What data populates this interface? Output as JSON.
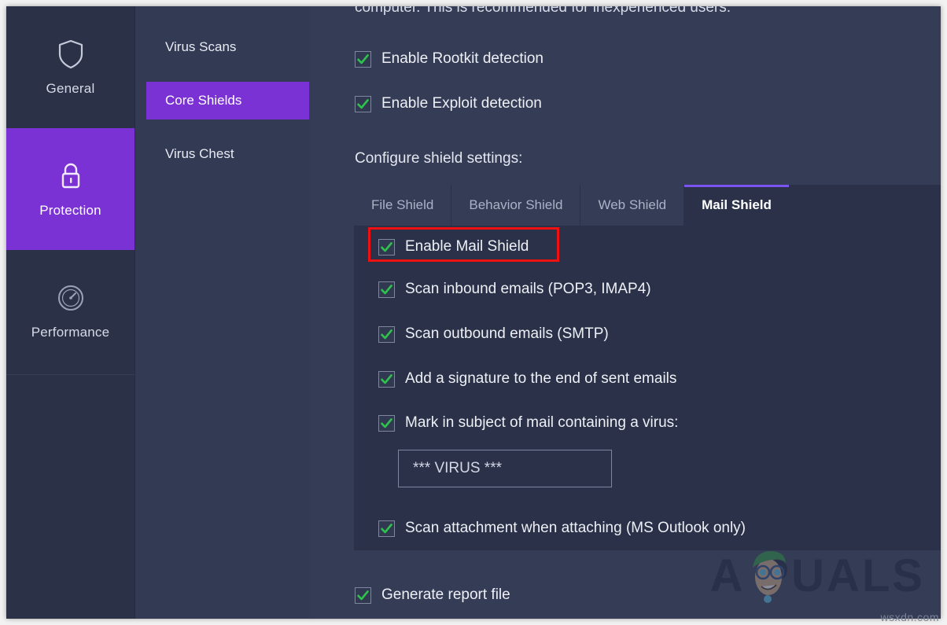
{
  "rail": {
    "items": [
      {
        "label": "General",
        "icon": "shield-icon",
        "active": false
      },
      {
        "label": "Protection",
        "icon": "lock-icon",
        "active": true
      },
      {
        "label": "Performance",
        "icon": "speedometer-icon",
        "active": false
      }
    ]
  },
  "nav2": {
    "items": [
      {
        "label": "Virus Scans",
        "active": false
      },
      {
        "label": "Core Shields",
        "active": true
      },
      {
        "label": "Virus Chest",
        "active": false
      }
    ]
  },
  "main": {
    "lede": "computer. This is recommended for inexperienced users.",
    "rootkit_label": "Enable Rootkit detection",
    "exploit_label": "Enable Exploit detection",
    "section_title": "Configure shield settings:",
    "tabs": [
      {
        "label": "File Shield",
        "active": false
      },
      {
        "label": "Behavior Shield",
        "active": false
      },
      {
        "label": "Web Shield",
        "active": false
      },
      {
        "label": "Mail Shield",
        "active": true
      }
    ],
    "panel_rows": [
      {
        "label": "Enable Mail Shield",
        "checked": true,
        "highlighted": true
      },
      {
        "label": "Scan inbound emails (POP3, IMAP4)",
        "checked": true,
        "highlighted": false
      },
      {
        "label": "Scan outbound emails (SMTP)",
        "checked": true,
        "highlighted": false
      },
      {
        "label": "Add a signature to the end of sent emails",
        "checked": true,
        "highlighted": false
      },
      {
        "label": "Mark in subject of mail containing a virus:",
        "checked": true,
        "highlighted": false
      },
      {
        "label": "Scan attachment when attaching (MS Outlook only)",
        "checked": true,
        "highlighted": false
      }
    ],
    "virus_subject_value": "*** VIRUS ***",
    "virus_subject_placeholder": "*** VIRUS ***",
    "generate_report_label": "Generate report file",
    "generate_report_checked": true
  },
  "watermark": {
    "brand": "A PUALS",
    "brand_before": "A",
    "brand_after": "PUALS",
    "credit": "wsxdn.com"
  },
  "colors": {
    "accent_purple": "#7b32d4",
    "tab_indicator": "#7b53f0",
    "check_green": "#2fc24d",
    "highlight_red": "#ee1111",
    "panel_bg": "#2a3148",
    "content_bg": "#343c56",
    "rail_bg": "#2b3248",
    "nav2_bg": "#323a54"
  }
}
